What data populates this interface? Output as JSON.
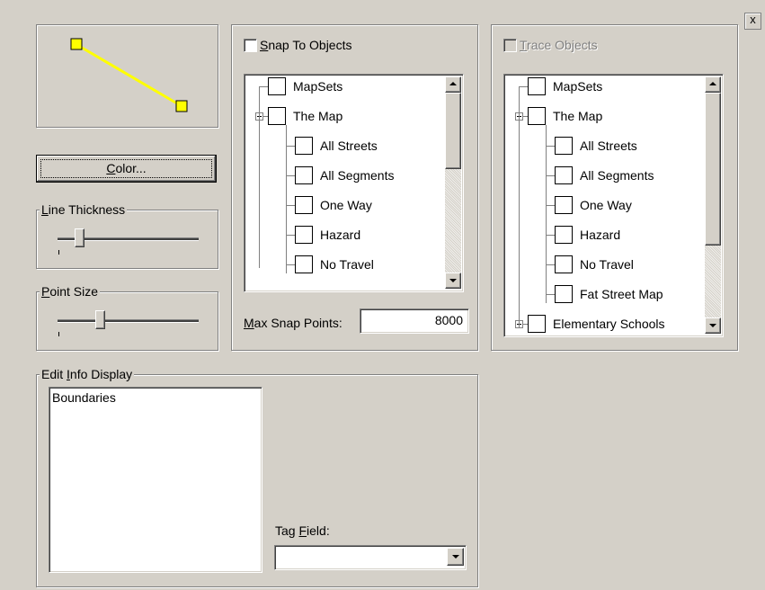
{
  "close_button": {
    "label": "x"
  },
  "line_preview": {
    "line_color": "#ffff00",
    "point_color": "#ffff00"
  },
  "color_button": {
    "label_u": "C",
    "label_rest": "olor..."
  },
  "line_thickness": {
    "title_u": "L",
    "title_rest": "ine Thickness",
    "value": 0.15
  },
  "point_size": {
    "title_u": "P",
    "title_rest": "oint Size",
    "value": 0.3
  },
  "snap": {
    "checkbox_u": "S",
    "checkbox_rest": "nap To Objects",
    "checked": false,
    "max_u": "M",
    "max_rest": "ax Snap Points:",
    "max_value": "8000",
    "tree": [
      {
        "label": "MapSets"
      },
      {
        "label": "The Map"
      },
      {
        "label": "All Streets"
      },
      {
        "label": "All Segments"
      },
      {
        "label": "One Way"
      },
      {
        "label": "Hazard"
      },
      {
        "label": "No Travel"
      }
    ]
  },
  "trace": {
    "checkbox_u": "T",
    "checkbox_rest": "race Objects",
    "checked": false,
    "tree": [
      {
        "label": "MapSets"
      },
      {
        "label": "The Map"
      },
      {
        "label": "All Streets"
      },
      {
        "label": "All Segments"
      },
      {
        "label": "One Way"
      },
      {
        "label": "Hazard"
      },
      {
        "label": "No Travel"
      },
      {
        "label": "Fat Street Map"
      },
      {
        "label": "Elementary Schools"
      }
    ]
  },
  "edit_info": {
    "title_pre": "Edit ",
    "title_u": "I",
    "title_rest": "nfo Display",
    "list_items": [
      "Boundaries"
    ],
    "tag_pre": "Tag ",
    "tag_u": "F",
    "tag_rest": "ield:",
    "tag_value": ""
  }
}
